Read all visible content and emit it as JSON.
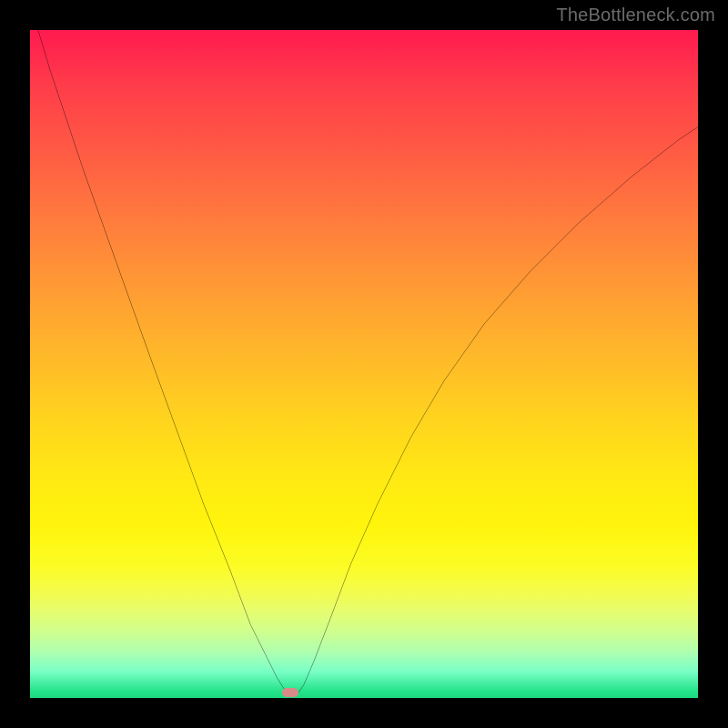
{
  "watermark": "TheBottleneck.com",
  "marker": {
    "x_pct": 39.0,
    "y_pct": 99.2
  },
  "colors": {
    "frame": "#000000",
    "curve": "#000000",
    "marker": "#d98a88",
    "watermark": "#6b6b6b"
  },
  "chart_data": {
    "type": "line",
    "title": "",
    "xlabel": "",
    "ylabel": "",
    "xlim_pct": [
      0,
      100
    ],
    "ylim_pct": [
      0,
      100
    ],
    "note": "Axes have no visible tick labels; x/y are in percent of plot area (0,0 = top-left).",
    "series": [
      {
        "name": "bottleneck-curve",
        "points_pct": [
          [
            0.0,
            -4.0
          ],
          [
            3.0,
            6.0
          ],
          [
            8.0,
            21.0
          ],
          [
            13.0,
            35.0
          ],
          [
            18.0,
            49.0
          ],
          [
            22.0,
            60.0
          ],
          [
            26.0,
            71.0
          ],
          [
            30.0,
            81.0
          ],
          [
            33.0,
            89.0
          ],
          [
            35.5,
            94.0
          ],
          [
            37.0,
            97.0
          ],
          [
            38.0,
            98.6
          ],
          [
            39.0,
            99.2
          ],
          [
            40.2,
            99.2
          ],
          [
            41.0,
            98.0
          ],
          [
            42.5,
            94.5
          ],
          [
            45.0,
            88.0
          ],
          [
            48.0,
            80.0
          ],
          [
            52.0,
            71.0
          ],
          [
            57.0,
            61.0
          ],
          [
            62.0,
            52.5
          ],
          [
            68.0,
            44.0
          ],
          [
            75.0,
            36.0
          ],
          [
            82.0,
            29.0
          ],
          [
            90.0,
            22.0
          ],
          [
            97.0,
            16.5
          ],
          [
            100.0,
            14.5
          ]
        ]
      }
    ],
    "marker_point_pct": [
      39.0,
      99.2
    ]
  }
}
